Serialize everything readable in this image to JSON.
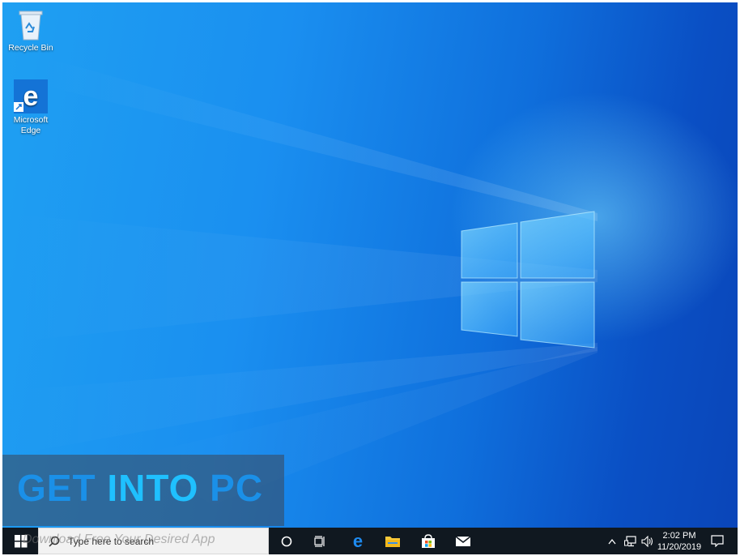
{
  "desktop": {
    "icons": [
      {
        "label": "Recycle Bin",
        "icon": "recycle-bin-icon"
      },
      {
        "label": "Microsoft Edge",
        "icon": "edge-icon"
      }
    ]
  },
  "watermark": {
    "part1": "GET ",
    "part2": "INTO",
    "part3": " PC",
    "overlay": "Download Free Your Desired App"
  },
  "taskbar": {
    "start": "windows-start-icon",
    "search_placeholder": "Type here to search",
    "pinned": [
      "cortana-icon",
      "task-view-icon",
      "edge-icon",
      "file-explorer-icon",
      "store-icon",
      "mail-icon"
    ],
    "tray": {
      "time": "2:02 PM",
      "date": "11/20/2019"
    }
  },
  "colors": {
    "wallpaper_light": "#1fa0f2",
    "wallpaper_dark": "#0a45b8",
    "taskbar": "#101820",
    "watermark_blue": "#1a90e8",
    "watermark_cyan": "#1fc0ff"
  }
}
